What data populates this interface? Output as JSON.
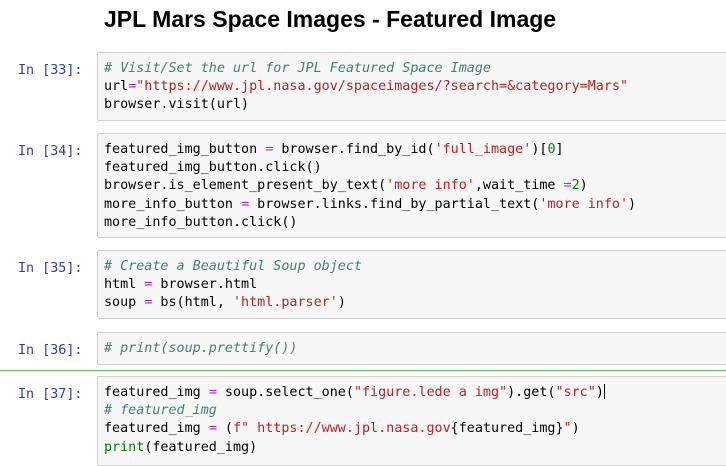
{
  "heading": "JPL Mars Space Images - Featured Image",
  "cells": [
    {
      "prompt": "In [33]:",
      "lines": [
        [
          {
            "t": "# Visit/Set the url for JPL Featured Space Image",
            "c": "c1"
          }
        ],
        [
          {
            "t": "url"
          },
          {
            "t": "=",
            "c": "o"
          },
          {
            "t": "\"https://www.jpl.nasa.gov/spaceimages/?search=&category=Mars\"",
            "c": "s"
          }
        ],
        [
          {
            "t": "browser.visit(url)"
          }
        ]
      ]
    },
    {
      "prompt": "In [34]:",
      "lines": [
        [
          {
            "t": "featured_img_button "
          },
          {
            "t": "=",
            "c": "o"
          },
          {
            "t": " browser.find_by_id("
          },
          {
            "t": "'full_image'",
            "c": "s"
          },
          {
            "t": ")["
          },
          {
            "t": "0",
            "c": "mi"
          },
          {
            "t": "]"
          }
        ],
        [
          {
            "t": "featured_img_button.click()"
          }
        ],
        [
          {
            "t": "browser.is_element_present_by_text("
          },
          {
            "t": "'more info'",
            "c": "s"
          },
          {
            "t": ",wait_time "
          },
          {
            "t": "=",
            "c": "o"
          },
          {
            "t": "2",
            "c": "mi"
          },
          {
            "t": ")"
          }
        ],
        [
          {
            "t": "more_info_button "
          },
          {
            "t": "=",
            "c": "o"
          },
          {
            "t": " browser.links.find_by_partial_text("
          },
          {
            "t": "'more info'",
            "c": "s"
          },
          {
            "t": ")"
          }
        ],
        [
          {
            "t": "more_info_button.click()"
          }
        ]
      ]
    },
    {
      "prompt": "In [35]:",
      "lines": [
        [
          {
            "t": "# Create a Beautiful Soup object",
            "c": "c1"
          }
        ],
        [
          {
            "t": "html "
          },
          {
            "t": "=",
            "c": "o"
          },
          {
            "t": " browser.html"
          }
        ],
        [
          {
            "t": "soup "
          },
          {
            "t": "=",
            "c": "o"
          },
          {
            "t": " bs(html, "
          },
          {
            "t": "'html.parser'",
            "c": "s"
          },
          {
            "t": ")"
          }
        ]
      ]
    },
    {
      "prompt": "In [36]:",
      "lines": [
        [
          {
            "t": "# print(soup.prettify())",
            "c": "c1"
          }
        ]
      ]
    },
    {
      "prompt": "In [37]:",
      "lines": [
        [
          {
            "t": "featured_img "
          },
          {
            "t": "=",
            "c": "o"
          },
          {
            "t": " soup.select_one("
          },
          {
            "t": "\"figure.lede a img\"",
            "c": "s"
          },
          {
            "t": ").get("
          },
          {
            "t": "\"src\"",
            "c": "s"
          },
          {
            "t": ")"
          }
        ],
        [
          {
            "t": "# featured_img",
            "c": "c1"
          }
        ],
        [
          {
            "t": "featured_img "
          },
          {
            "t": "=",
            "c": "o"
          },
          {
            "t": " ("
          },
          {
            "t": "f\" https://www.jpl.nasa.gov",
            "c": "s"
          },
          {
            "t": "{featured_img}"
          },
          {
            "t": "\"",
            "c": "s"
          },
          {
            "t": ")"
          }
        ],
        [
          {
            "t": "print",
            "c": "nb"
          },
          {
            "t": "(featured_img)"
          }
        ]
      ]
    }
  ],
  "colors": {
    "prompt": "#303f9f",
    "comment": "#408080",
    "string": "#ba2121",
    "operator": "#aa22ff",
    "builtin": "#008000",
    "selected_bar": "#66bb6a"
  }
}
